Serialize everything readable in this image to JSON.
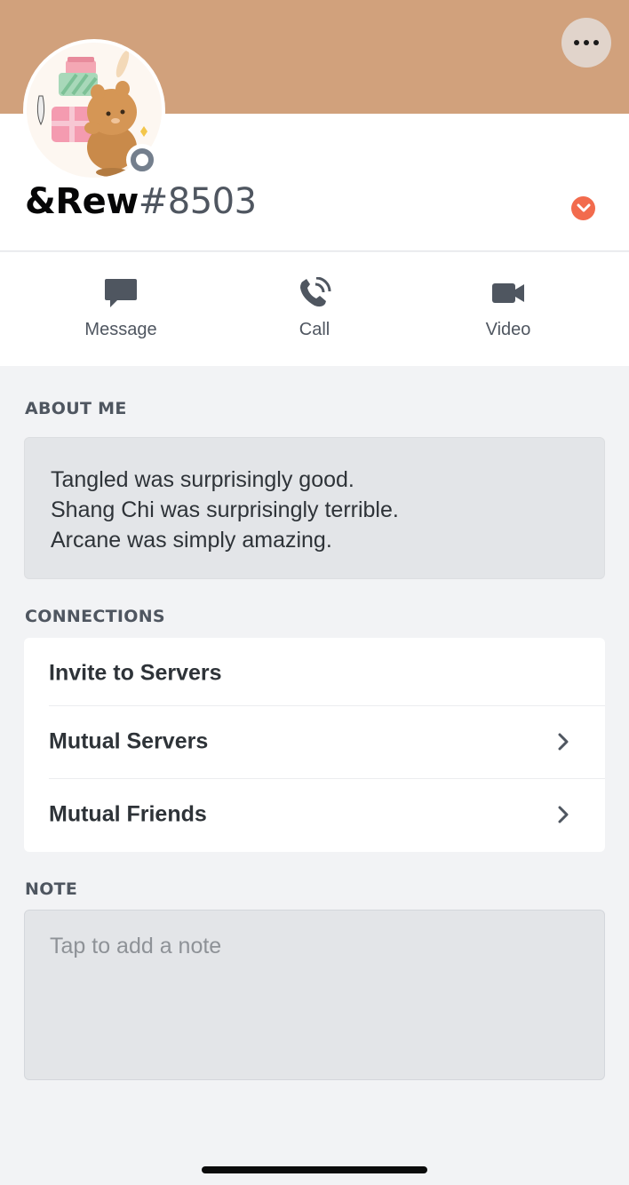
{
  "header": {
    "more_button_icon": "more-dots-icon",
    "banner_color": "#d1a17c"
  },
  "profile": {
    "avatar_icon": "avatar-bear-with-gifts",
    "status": "offline",
    "username": "&Rew",
    "discriminator": "#8503",
    "badge_icon": "chevron-down-badge-icon",
    "badge_color": "#f26b4d"
  },
  "actions": [
    {
      "label": "Message",
      "icon": "chat-bubble-icon"
    },
    {
      "label": "Call",
      "icon": "phone-icon"
    },
    {
      "label": "Video",
      "icon": "video-camera-icon"
    }
  ],
  "about": {
    "title": "ABOUT ME",
    "lines": [
      "Tangled was surprisingly good.",
      "Shang Chi was surprisingly terrible.",
      "Arcane was simply amazing."
    ]
  },
  "connections": {
    "title": "CONNECTIONS",
    "items": [
      {
        "label": "Invite to Servers",
        "has_chevron": false
      },
      {
        "label": "Mutual Servers",
        "has_chevron": true
      },
      {
        "label": "Mutual Friends",
        "has_chevron": true
      }
    ]
  },
  "note": {
    "title": "NOTE",
    "placeholder": "Tap to add a note"
  }
}
